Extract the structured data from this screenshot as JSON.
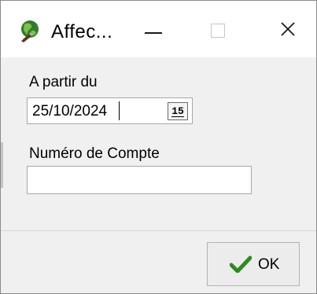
{
  "window": {
    "title": "Affec...",
    "icon": "app-globe-icon",
    "controls": {
      "minimize": "minimize-icon",
      "maximize": "maximize-icon",
      "close": "close-icon"
    }
  },
  "form": {
    "date_label": "A partir du",
    "date_value": "25/10/2024",
    "calendar_button_text": "15",
    "account_label": "Numéro de Compte",
    "account_value": ""
  },
  "footer": {
    "ok_label": "OK",
    "ok_icon": "checkmark-icon",
    "ok_icon_color": "#2e8b1e"
  }
}
